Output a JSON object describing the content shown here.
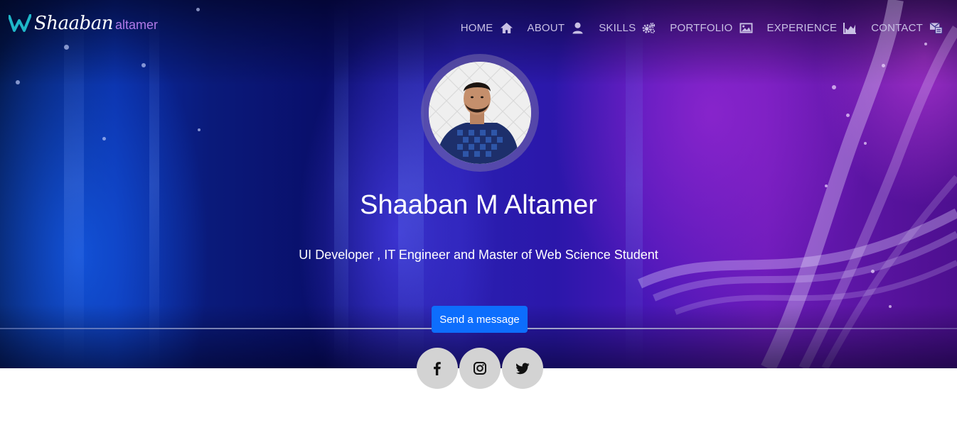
{
  "brand": {
    "name": "Shaaban",
    "sub": "altamer"
  },
  "nav": [
    {
      "label": "HOME",
      "icon": "home-icon"
    },
    {
      "label": "ABOUT",
      "icon": "user-icon"
    },
    {
      "label": "SKILLS",
      "icon": "gears-icon"
    },
    {
      "label": "PORTFOLIO",
      "icon": "image-icon"
    },
    {
      "label": "EXPERIENCE",
      "icon": "chart-icon"
    },
    {
      "label": "CONTACT",
      "icon": "contact-icon"
    }
  ],
  "hero": {
    "name": "Shaaban M Altamer",
    "tagline": "UI Developer , IT Engineer and Master of Web Science Student",
    "cta_label": "Send a message"
  },
  "social": [
    {
      "icon": "facebook-icon"
    },
    {
      "icon": "instagram-icon"
    },
    {
      "icon": "twitter-icon"
    }
  ],
  "colors": {
    "brand_accent": "#b07ae8",
    "brand_mark": "#1fb7c9",
    "nav_text": "#c8c0e4",
    "cta_bg": "#0d6efd",
    "social_bg": "#d3d3d3"
  }
}
